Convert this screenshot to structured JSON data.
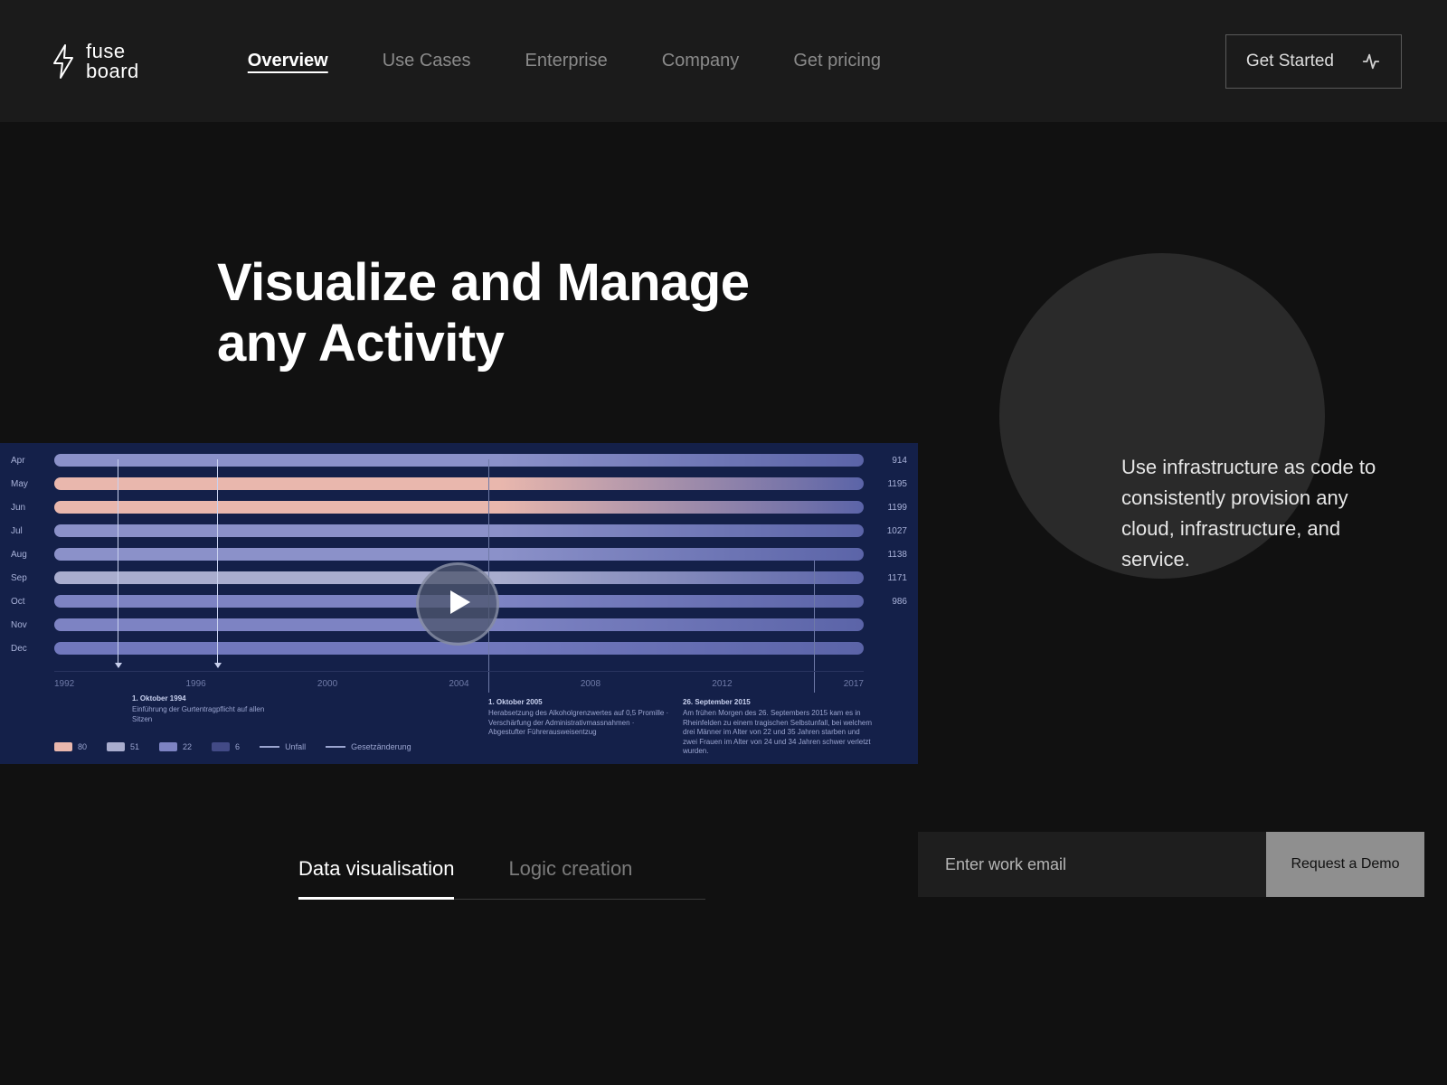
{
  "brand": {
    "line1": "fuse",
    "line2": "board"
  },
  "nav": {
    "items": [
      {
        "label": "Overview",
        "active": true
      },
      {
        "label": "Use Cases",
        "active": false
      },
      {
        "label": "Enterprise",
        "active": false
      },
      {
        "label": "Company",
        "active": false
      },
      {
        "label": "Get pricing",
        "active": false
      }
    ],
    "cta": "Get Started"
  },
  "hero": {
    "title_l1": "Visualize and Manage",
    "title_l2": "any Activity",
    "copy": "Use infrastructure as code to consistently provision any cloud, infrastructure, and service."
  },
  "chart": {
    "months": [
      "Apr",
      "May",
      "Jun",
      "Jul",
      "Aug",
      "Sep",
      "Oct",
      "Nov",
      "Dec"
    ],
    "right_values": [
      "914",
      "1195",
      "1199",
      "1027",
      "1138",
      "1171",
      "986",
      "",
      ""
    ],
    "band_colors": [
      "#8b91c9",
      "#e9b7ad",
      "#e9b7ad",
      "#8b91c9",
      "#8b91c9",
      "#a9adce",
      "#7d83c3",
      "#7d83c3",
      "#7178bd"
    ],
    "years": [
      "1992",
      "1996",
      "2000",
      "2004",
      "2008",
      "2012",
      "2017"
    ],
    "legend": [
      {
        "kind": "sw",
        "color": "#e9b7ad",
        "label": "80"
      },
      {
        "kind": "sw",
        "color": "#a9adce",
        "label": "51"
      },
      {
        "kind": "sw",
        "color": "#7d83c3",
        "label": "22"
      },
      {
        "kind": "sw",
        "color": "#424a86",
        "label": "6"
      },
      {
        "kind": "ln",
        "color": "#9aa4cf",
        "label": "Unfall"
      },
      {
        "kind": "ln",
        "color": "#9aa4cf",
        "label": "Gesetzänderung"
      }
    ],
    "annotations": [
      {
        "title": "1. Oktober 1994",
        "text": "Einführung der Gurtentragpflicht auf allen Sitzen"
      },
      {
        "title": "1. Oktober 2005",
        "text": "Herabsetzung des Alkoholgrenzwertes auf 0,5 Promille · Verschärfung der Administrativmassnahmen · Abgestufter Führerausweisentzug"
      },
      {
        "title": "26. September 2015",
        "text": "Am frühen Morgen des 26. Septembers 2015 kam es in Rheinfelden zu einem tragischen Selbstunfall, bei welchem drei Männer im Alter von 22 und 35 Jahren starben und zwei Frauen im Alter von 24 und 34 Jahren schwer verletzt wurden."
      }
    ]
  },
  "subtabs": [
    {
      "label": "Data visualisation",
      "active": true
    },
    {
      "label": "Logic creation",
      "active": false
    }
  ],
  "email": {
    "placeholder": "Enter work email",
    "button": "Request a Demo"
  }
}
